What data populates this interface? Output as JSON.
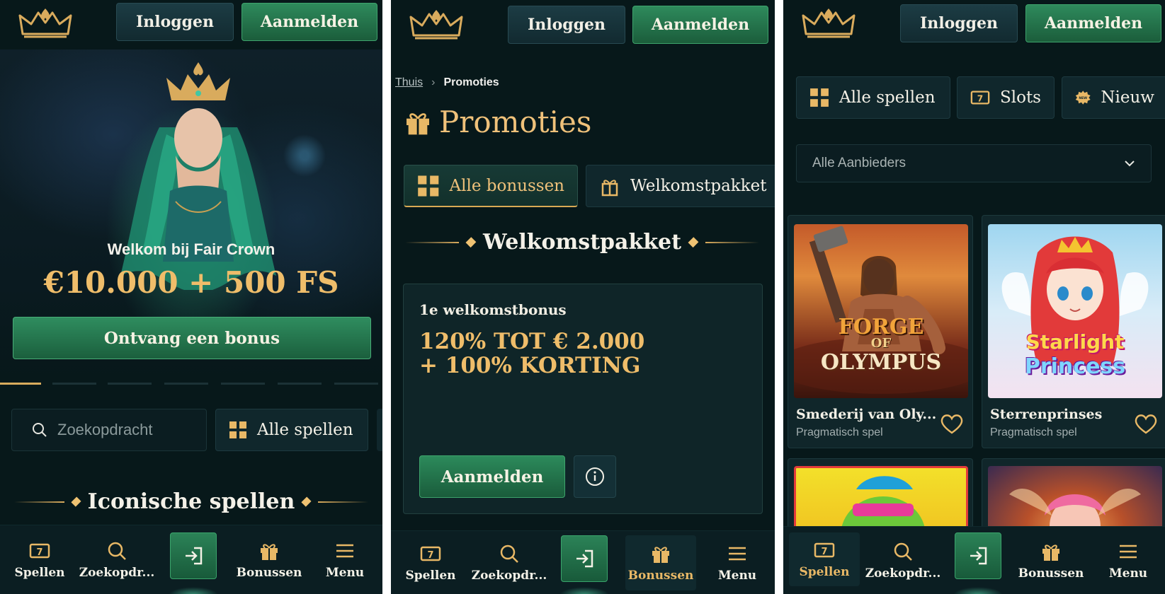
{
  "header": {
    "login_label": "Inloggen",
    "register_label": "Aanmelden",
    "logo_icon": "crown-icon"
  },
  "screen1": {
    "hero": {
      "subtitle": "Welkom bij Fair Crown",
      "amount": "€10.000 + 500 FS",
      "cta_label": "Ontvang een bonus"
    },
    "carousel_slides": 7,
    "carousel_active": 1,
    "search": {
      "placeholder": "Zoekopdracht"
    },
    "all_games_label": "Alle spellen",
    "section_title": "Iconische spellen"
  },
  "screen2": {
    "breadcrumb": {
      "home": "Thuis",
      "current": "Promoties"
    },
    "title": "Promoties",
    "tabs": [
      {
        "label": "Alle bonussen",
        "icon": "grid-icon",
        "active": true
      },
      {
        "label": "Welkomstpakket",
        "icon": "gift-icon",
        "active": false
      }
    ],
    "section_title": "Welkomstpakket",
    "bonus": {
      "label": "1e welkomstbonus",
      "value_line1": "120% TOT € 2.000",
      "value_line2": "+ 100% KORTING",
      "register_label": "Aanmelden",
      "info_icon": "info-icon"
    }
  },
  "screen3": {
    "categories": [
      {
        "label": "Alle spellen",
        "icon": "grid-icon"
      },
      {
        "label": "Slots",
        "icon": "slot-777-icon"
      },
      {
        "label": "Nieuw",
        "icon": "new-badge-icon"
      }
    ],
    "provider_select": {
      "value": "Alle Aanbieders"
    },
    "games": [
      {
        "name": "Smederij van Oly...",
        "provider": "Pragmatisch spel",
        "art_title_1": "FORGE",
        "art_title_2": "OF",
        "art_title_3": "OLYMPUS"
      },
      {
        "name": "Sterrenprinses",
        "provider": "Pragmatisch spel",
        "art_title_1": "Starlight",
        "art_title_2": "Princess"
      }
    ]
  },
  "bottom_nav": {
    "items": [
      {
        "label": "Spellen",
        "icon": "slot-777-icon"
      },
      {
        "label": "Zoekopdr...",
        "icon": "search-icon"
      },
      {
        "label": "",
        "icon": "login-arrow-icon"
      },
      {
        "label": "Bonussen",
        "icon": "gift-icon"
      },
      {
        "label": "Menu",
        "icon": "hamburger-menu-icon"
      }
    ],
    "active_by_screen": [
      "none",
      "Bonussen",
      "Spellen"
    ]
  },
  "colors": {
    "background": "#07181a",
    "gold": "#efbd6a",
    "green_button": "#2c8a5b",
    "dark_button": "#163238"
  }
}
